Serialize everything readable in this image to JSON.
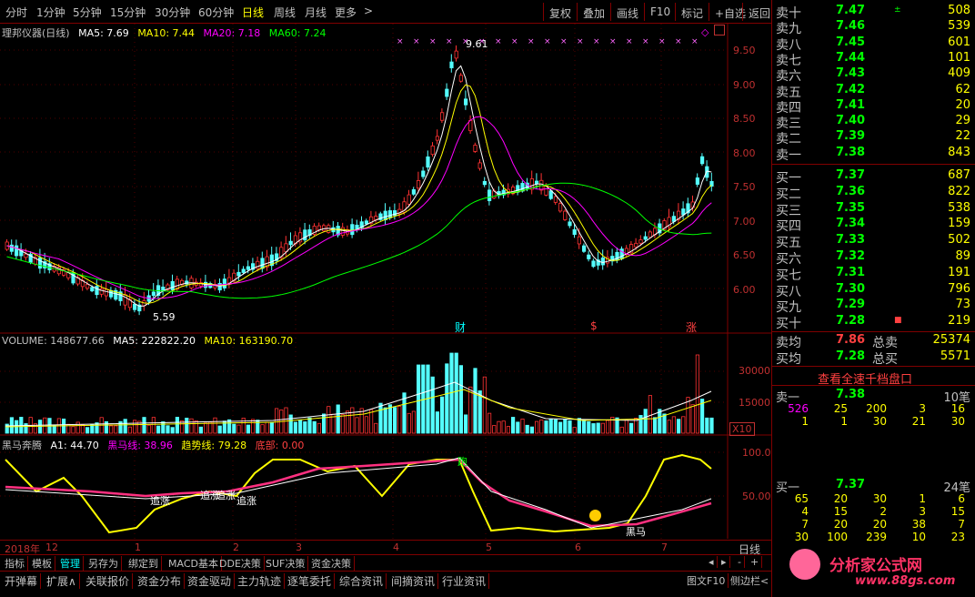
{
  "toolbar": {
    "periods": [
      "分时",
      "1分钟",
      "5分钟",
      "15分钟",
      "30分钟",
      "60分钟",
      "日线",
      "周线",
      "月线",
      "更多"
    ],
    "active_period": "日线",
    "more_arrow": ">",
    "buttons": [
      "复权",
      "叠加",
      "画线",
      "F10",
      "标记",
      "+自选",
      "返回"
    ]
  },
  "main_pane": {
    "title": "理邦仪器(日线)",
    "ma5": "MA5: 7.69",
    "ma10": "MA10: 7.44",
    "ma20": "MA20: 7.18",
    "ma60": "MA60: 7.24",
    "high_label": "9.61",
    "low_label": "5.59",
    "yticks": [
      "9.50",
      "9.00",
      "8.50",
      "8.00",
      "7.50",
      "7.00",
      "6.50",
      "6.00"
    ],
    "markers": [
      "财",
      "$",
      "涨"
    ],
    "colors": {
      "ma5": "#ffffff",
      "ma10": "#ffff00",
      "ma20": "#ff00ff",
      "ma60": "#00ff00",
      "up": "#ff3232",
      "down": "#54ffff"
    }
  },
  "volume_pane": {
    "title": "VOLUME: 148677.66",
    "ma5": "MA5: 222822.20",
    "ma10": "MA10: 163190.70",
    "yticks": [
      "30000",
      "15000"
    ],
    "unit": "X10"
  },
  "indicator_pane": {
    "title": "黑马奔腾",
    "a1": "A1: 44.70",
    "heima": "黑马线: 38.96",
    "trend": "趋势线: 79.28",
    "bottom": "底部: 0.00",
    "yticks": [
      "100.0",
      "50.00"
    ],
    "annotations": [
      "追涨",
      "追涨",
      "追涨",
      "追涨",
      "跑",
      "黑马"
    ]
  },
  "time_axis": {
    "labels": [
      "2018年",
      "12",
      "1",
      "2",
      "3",
      "4",
      "5",
      "6",
      "7"
    ],
    "period_label": "日线"
  },
  "bottom_tabs_1": [
    "指标",
    "模板",
    "管理",
    "另存为",
    "绑定到",
    "MACD基本",
    "DDE决策",
    "SUF决策",
    "资金决策"
  ],
  "bottom_tabs_1_active": "管理",
  "bottom_tabs_1_nav": [
    "◂",
    "▸",
    "-",
    "+"
  ],
  "bottom_tabs_2": [
    "开弹幕",
    "扩展∧",
    "关联报价",
    "资金分布",
    "资金驱动",
    "主力轨迹",
    "逐笔委托",
    "综合资讯",
    "间摘资讯",
    "行业资讯"
  ],
  "bottom_right": [
    "图文F10",
    "侧边栏<"
  ],
  "order_book": {
    "sell": [
      {
        "label": "卖十",
        "price": "7.47",
        "mark": "±",
        "vol": "508"
      },
      {
        "label": "卖九",
        "price": "7.46",
        "mark": "",
        "vol": "539"
      },
      {
        "label": "卖八",
        "price": "7.45",
        "mark": "",
        "vol": "601"
      },
      {
        "label": "卖七",
        "price": "7.44",
        "mark": "",
        "vol": "101"
      },
      {
        "label": "卖六",
        "price": "7.43",
        "mark": "",
        "vol": "409"
      },
      {
        "label": "卖五",
        "price": "7.42",
        "mark": "",
        "vol": "62"
      },
      {
        "label": "卖四",
        "price": "7.41",
        "mark": "",
        "vol": "20"
      },
      {
        "label": "卖三",
        "price": "7.40",
        "mark": "",
        "vol": "29"
      },
      {
        "label": "卖二",
        "price": "7.39",
        "mark": "",
        "vol": "22"
      },
      {
        "label": "卖一",
        "price": "7.38",
        "mark": "",
        "vol": "843"
      }
    ],
    "buy": [
      {
        "label": "买一",
        "price": "7.37",
        "mark": "",
        "vol": "687"
      },
      {
        "label": "买二",
        "price": "7.36",
        "mark": "",
        "vol": "822"
      },
      {
        "label": "买三",
        "price": "7.35",
        "mark": "",
        "vol": "538"
      },
      {
        "label": "买四",
        "price": "7.34",
        "mark": "",
        "vol": "159"
      },
      {
        "label": "买五",
        "price": "7.33",
        "mark": "",
        "vol": "502"
      },
      {
        "label": "买六",
        "price": "7.32",
        "mark": "",
        "vol": "89"
      },
      {
        "label": "买七",
        "price": "7.31",
        "mark": "",
        "vol": "191"
      },
      {
        "label": "买八",
        "price": "7.30",
        "mark": "",
        "vol": "796"
      },
      {
        "label": "买九",
        "price": "7.29",
        "mark": "",
        "vol": "73"
      },
      {
        "label": "买十",
        "price": "7.28",
        "mark": "■",
        "vol": "219"
      }
    ],
    "summary": [
      {
        "label": "卖均",
        "price": "7.86",
        "lab2": "总卖",
        "vol": "25374"
      },
      {
        "label": "买均",
        "price": "7.28",
        "lab2": "总买",
        "vol": "5571"
      }
    ],
    "full_depth_button": "查看全速千档盘口",
    "sell1_queue": {
      "label": "卖一",
      "price": "7.38",
      "count": "10笔",
      "rows": [
        [
          "526",
          "25",
          "200",
          "3",
          "16"
        ],
        [
          "1",
          "1",
          "30",
          "21",
          "30"
        ]
      ]
    },
    "buy1_queue": {
      "label": "买一",
      "price": "7.37",
      "count": "24笔",
      "rows": [
        [
          "65",
          "20",
          "30",
          "1",
          "6"
        ],
        [
          "4",
          "15",
          "2",
          "3",
          "15"
        ],
        [
          "7",
          "20",
          "20",
          "38",
          "7"
        ],
        [
          "30",
          "100",
          "239",
          "10",
          "23"
        ]
      ]
    }
  },
  "watermark": {
    "text": "分析家公式网",
    "url": "www.88gs.com"
  }
}
